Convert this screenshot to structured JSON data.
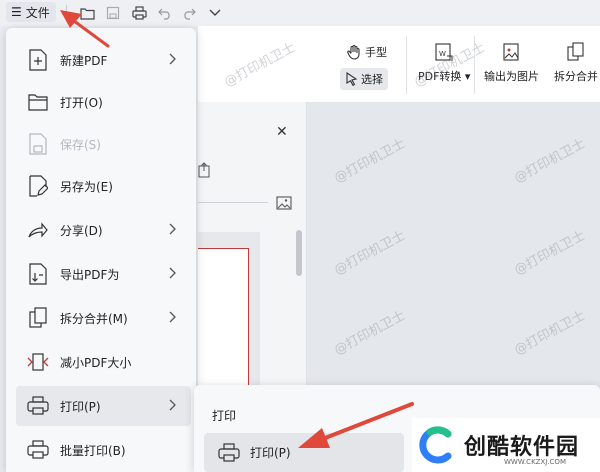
{
  "topbar": {
    "menu_icon_char": "☰",
    "file_label": "文件"
  },
  "ribbon": {
    "hand_label": "手型",
    "select_label": "选择",
    "pdf_convert_label": "PDF转换",
    "export_image_label": "输出为图片",
    "split_merge_label": "拆分合并"
  },
  "file_menu": {
    "items": [
      {
        "label": "新建PDF",
        "icon": "new-pdf-icon",
        "has_submenu": true,
        "enabled": true
      },
      {
        "label": "打开(O)",
        "icon": "folder-open-icon",
        "has_submenu": false,
        "enabled": true
      },
      {
        "label": "保存(S)",
        "icon": "save-icon",
        "has_submenu": false,
        "enabled": false
      },
      {
        "label": "另存为(E)",
        "icon": "save-as-icon",
        "has_submenu": false,
        "enabled": true
      },
      {
        "label": "分享(D)",
        "icon": "share-icon",
        "has_submenu": true,
        "enabled": true
      },
      {
        "label": "导出PDF为",
        "icon": "export-pdf-icon",
        "has_submenu": true,
        "enabled": true
      },
      {
        "label": "拆分合并(M)",
        "icon": "split-merge-icon",
        "has_submenu": true,
        "enabled": true
      },
      {
        "label": "减小PDF大小",
        "icon": "compress-icon",
        "has_submenu": false,
        "enabled": true
      },
      {
        "label": "打印(P)",
        "icon": "printer-icon",
        "has_submenu": true,
        "enabled": true,
        "active": true
      },
      {
        "label": "批量打印(B)",
        "icon": "batch-print-icon",
        "has_submenu": false,
        "enabled": true
      }
    ]
  },
  "print_submenu": {
    "title": "打印",
    "print_label": "打印(P)"
  },
  "panel": {
    "close_char": "✕"
  },
  "watermark_text": "@打印机卫士",
  "logo": {
    "text": "创酷软件园",
    "url": "WWW.CKZXJ.COM"
  },
  "colors": {
    "accent_red": "#c23a3a",
    "arrow_red": "#e0483b"
  }
}
